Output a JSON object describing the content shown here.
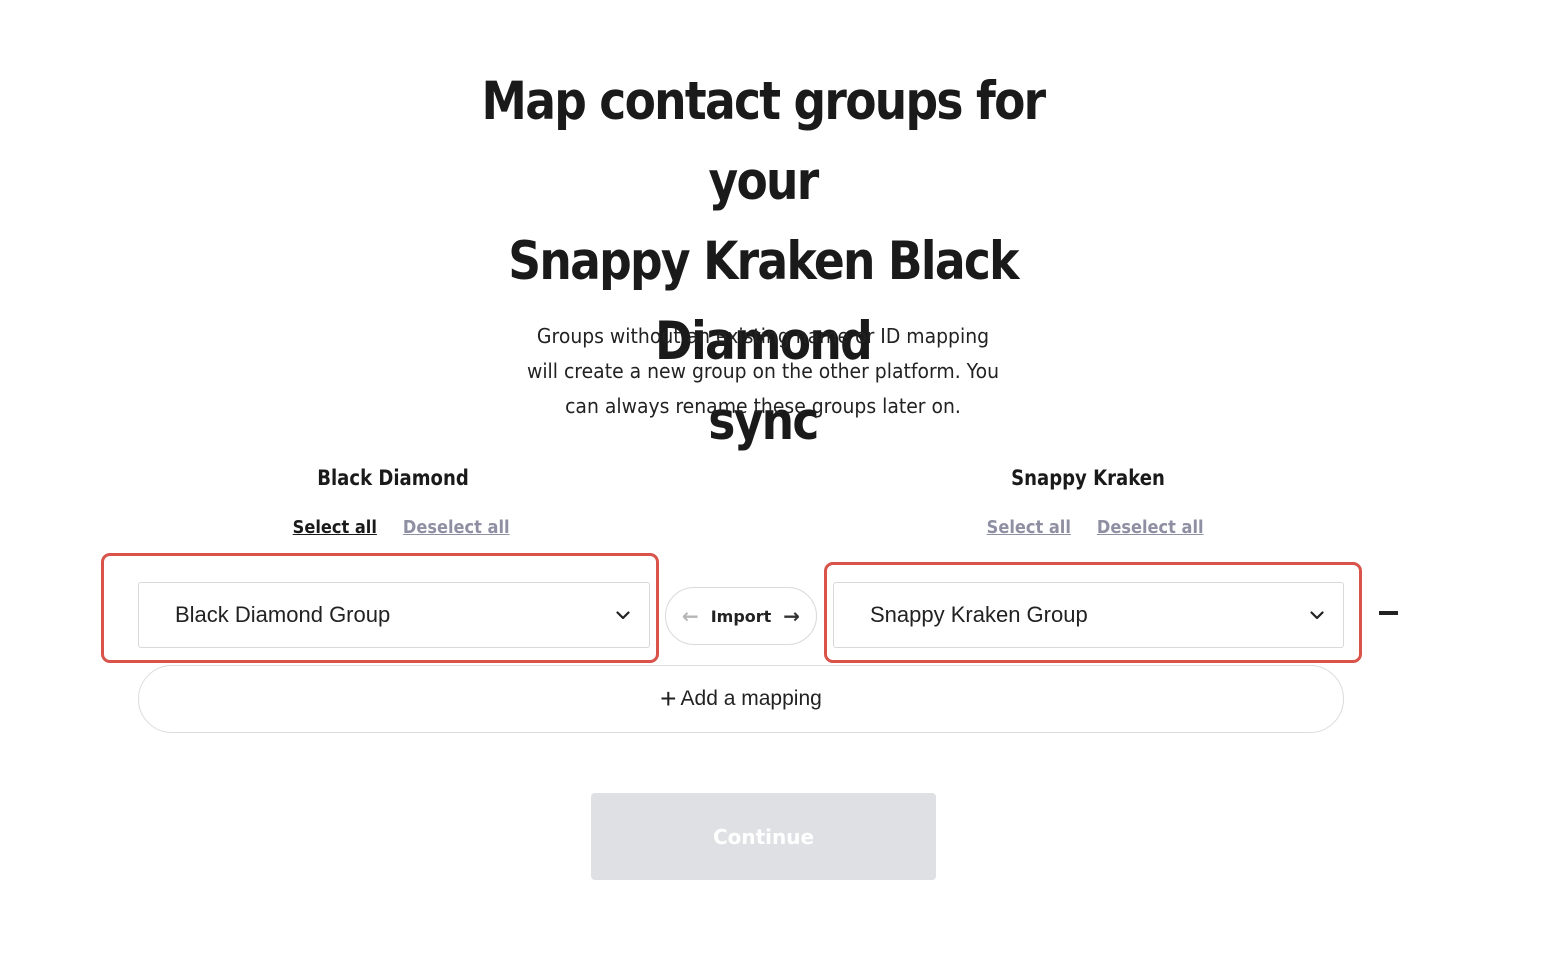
{
  "header": {
    "title_line1": "Map contact groups for your",
    "title_line2": "Snappy Kraken Black Diamond",
    "title_line3": "sync",
    "subtitle_line1": "Groups without an existing name or ID mapping",
    "subtitle_line2": "will create a new group on the other platform. You",
    "subtitle_line3": "can always rename these groups later on."
  },
  "left_column": {
    "heading": "Black Diamond",
    "select_all": "Select all",
    "deselect_all": "Deselect all",
    "selected_value": "Black Diamond Group"
  },
  "right_column": {
    "heading": "Snappy Kraken",
    "select_all": "Select all",
    "deselect_all": "Deselect all",
    "selected_value": "Snappy Kraken Group"
  },
  "direction": {
    "label": "Import",
    "left_arrow": "←",
    "right_arrow": "→"
  },
  "add_mapping": {
    "icon": "+",
    "label": "Add a mapping"
  },
  "continue": {
    "label": "Continue",
    "disabled": true
  },
  "colors": {
    "highlight": "#d9534a",
    "muted_link": "#8f8fa3",
    "disabled_button": "#dfe0e4"
  }
}
